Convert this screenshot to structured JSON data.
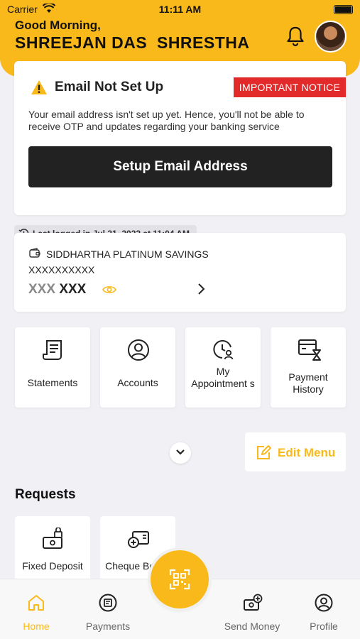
{
  "status_bar": {
    "carrier": "Carrier",
    "time": "11:11 AM"
  },
  "header": {
    "greeting": "Good Morning,",
    "user_name": "SHREEJAN DAS  SHRESTHA"
  },
  "notice": {
    "title": "Email Not Set Up",
    "badge": "IMPORTANT NOTICE",
    "message": "Your email address isn't set up yet. Hence, you'll not be able to receive OTP and updates regarding your banking service",
    "button_label": "Setup Email Address"
  },
  "last_login": "Last logged in Jul 31, 2022 at 11:04 AM",
  "account": {
    "name": "SIDDHARTHA PLATINUM SAVINGS",
    "number": "XXXXXXXXXX",
    "currency_mask": "XXX",
    "balance_mask": "XXX"
  },
  "quick_menu": [
    {
      "label": "Statements",
      "icon": "statement-icon"
    },
    {
      "label": "Accounts",
      "icon": "user-circle-icon"
    },
    {
      "label": "My Appointment s",
      "icon": "clock-user-icon"
    },
    {
      "label": "Payment History",
      "icon": "payment-history-icon"
    }
  ],
  "edit_menu_label": "Edit Menu",
  "requests": {
    "title": "Requests",
    "items": [
      {
        "label": "Fixed Deposit",
        "icon": "fixed-deposit-icon"
      },
      {
        "label": "Cheque Books",
        "icon": "cheque-book-icon"
      }
    ]
  },
  "tab_bar": [
    {
      "label": "Home",
      "icon": "home-icon",
      "active": true
    },
    {
      "label": "Payments",
      "icon": "payments-icon",
      "active": false
    },
    {
      "label": "Send Money",
      "icon": "send-money-icon",
      "active": false
    },
    {
      "label": "Profile",
      "icon": "profile-icon",
      "active": false
    }
  ],
  "colors": {
    "accent": "#f9b91b",
    "danger": "#e32a2a",
    "dark_button": "#222222"
  }
}
